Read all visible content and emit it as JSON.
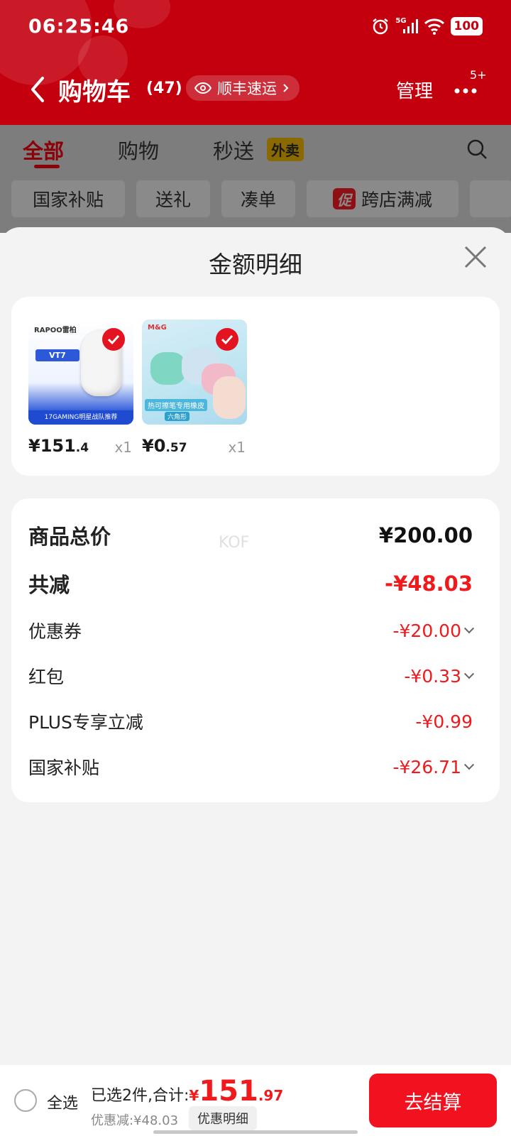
{
  "status": {
    "time": "06:25:46",
    "network": "5G",
    "battery": "100"
  },
  "header": {
    "title": "购物车",
    "count": "(47)",
    "shipping_pill": "顺丰速运",
    "manage": "管理",
    "more_badge": "5+"
  },
  "tabs": [
    {
      "label": "全部"
    },
    {
      "label": "购物"
    },
    {
      "label": "秒送"
    }
  ],
  "tab_badge": "外卖",
  "chips": [
    {
      "label": "国家补贴"
    },
    {
      "label": "送礼"
    },
    {
      "label": "凑单"
    },
    {
      "label": "跨店满减",
      "icon_text": "促"
    }
  ],
  "sheet": {
    "title": "金额明细",
    "products": [
      {
        "price_int": "¥151",
        "price_dec": ".4",
        "qty": "x1",
        "brand": "RAPOO雷柏",
        "model": "VT7",
        "banner": "17GAMING明星战队推荐"
      },
      {
        "price_int": "¥0",
        "price_dec": ".57",
        "qty": "x1",
        "brand": "M&G",
        "banner": "热可擦笔专用橡皮",
        "sub": "六角形"
      }
    ],
    "watermark": "KOF",
    "rows": [
      {
        "label": "商品总价",
        "value": "¥200.00"
      },
      {
        "label": "共减",
        "value": "-¥48.03"
      },
      {
        "label": "优惠券",
        "value": "-¥20.00"
      },
      {
        "label": "红包",
        "value": "-¥0.33"
      },
      {
        "label": "PLUS专享立减",
        "value": "-¥0.99"
      },
      {
        "label": "国家补贴",
        "value": "-¥26.71"
      }
    ]
  },
  "bottom": {
    "select_all": "全选",
    "summary_prefix": "已选2件,合计:",
    "yen": "¥",
    "total_int": "151",
    "total_dec": ".97",
    "discount": "优惠减:¥48.03",
    "detail_button": "优惠明细",
    "checkout": "去结算"
  },
  "colors": {
    "brand_red": "#c4000f",
    "price_red": "#f0191c",
    "checkout_red": "#f2121f"
  }
}
